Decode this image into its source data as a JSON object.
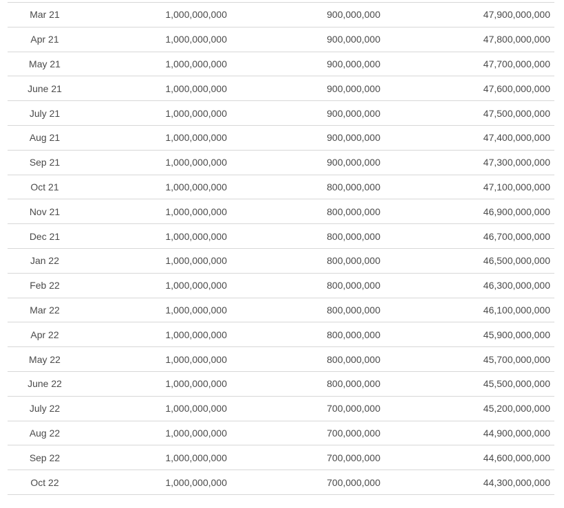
{
  "rows": [
    {
      "month": "Mar 21",
      "col1": "1,000,000,000",
      "col2": "900,000,000",
      "col3": "47,900,000,000"
    },
    {
      "month": "Apr 21",
      "col1": "1,000,000,000",
      "col2": "900,000,000",
      "col3": "47,800,000,000"
    },
    {
      "month": "May 21",
      "col1": "1,000,000,000",
      "col2": "900,000,000",
      "col3": "47,700,000,000"
    },
    {
      "month": "June 21",
      "col1": "1,000,000,000",
      "col2": "900,000,000",
      "col3": "47,600,000,000"
    },
    {
      "month": "July 21",
      "col1": "1,000,000,000",
      "col2": "900,000,000",
      "col3": "47,500,000,000"
    },
    {
      "month": "Aug 21",
      "col1": "1,000,000,000",
      "col2": "900,000,000",
      "col3": "47,400,000,000"
    },
    {
      "month": "Sep 21",
      "col1": "1,000,000,000",
      "col2": "900,000,000",
      "col3": "47,300,000,000"
    },
    {
      "month": "Oct 21",
      "col1": "1,000,000,000",
      "col2": "800,000,000",
      "col3": "47,100,000,000"
    },
    {
      "month": "Nov 21",
      "col1": "1,000,000,000",
      "col2": "800,000,000",
      "col3": "46,900,000,000"
    },
    {
      "month": "Dec 21",
      "col1": "1,000,000,000",
      "col2": "800,000,000",
      "col3": "46,700,000,000"
    },
    {
      "month": "Jan 22",
      "col1": "1,000,000,000",
      "col2": "800,000,000",
      "col3": "46,500,000,000"
    },
    {
      "month": "Feb 22",
      "col1": "1,000,000,000",
      "col2": "800,000,000",
      "col3": "46,300,000,000"
    },
    {
      "month": "Mar 22",
      "col1": "1,000,000,000",
      "col2": "800,000,000",
      "col3": "46,100,000,000"
    },
    {
      "month": "Apr 22",
      "col1": "1,000,000,000",
      "col2": "800,000,000",
      "col3": "45,900,000,000"
    },
    {
      "month": "May 22",
      "col1": "1,000,000,000",
      "col2": "800,000,000",
      "col3": "45,700,000,000"
    },
    {
      "month": "June 22",
      "col1": "1,000,000,000",
      "col2": "800,000,000",
      "col3": "45,500,000,000"
    },
    {
      "month": "July 22",
      "col1": "1,000,000,000",
      "col2": "700,000,000",
      "col3": "45,200,000,000"
    },
    {
      "month": "Aug 22",
      "col1": "1,000,000,000",
      "col2": "700,000,000",
      "col3": "44,900,000,000"
    },
    {
      "month": "Sep 22",
      "col1": "1,000,000,000",
      "col2": "700,000,000",
      "col3": "44,600,000,000"
    },
    {
      "month": "Oct 22",
      "col1": "1,000,000,000",
      "col2": "700,000,000",
      "col3": "44,300,000,000"
    }
  ]
}
